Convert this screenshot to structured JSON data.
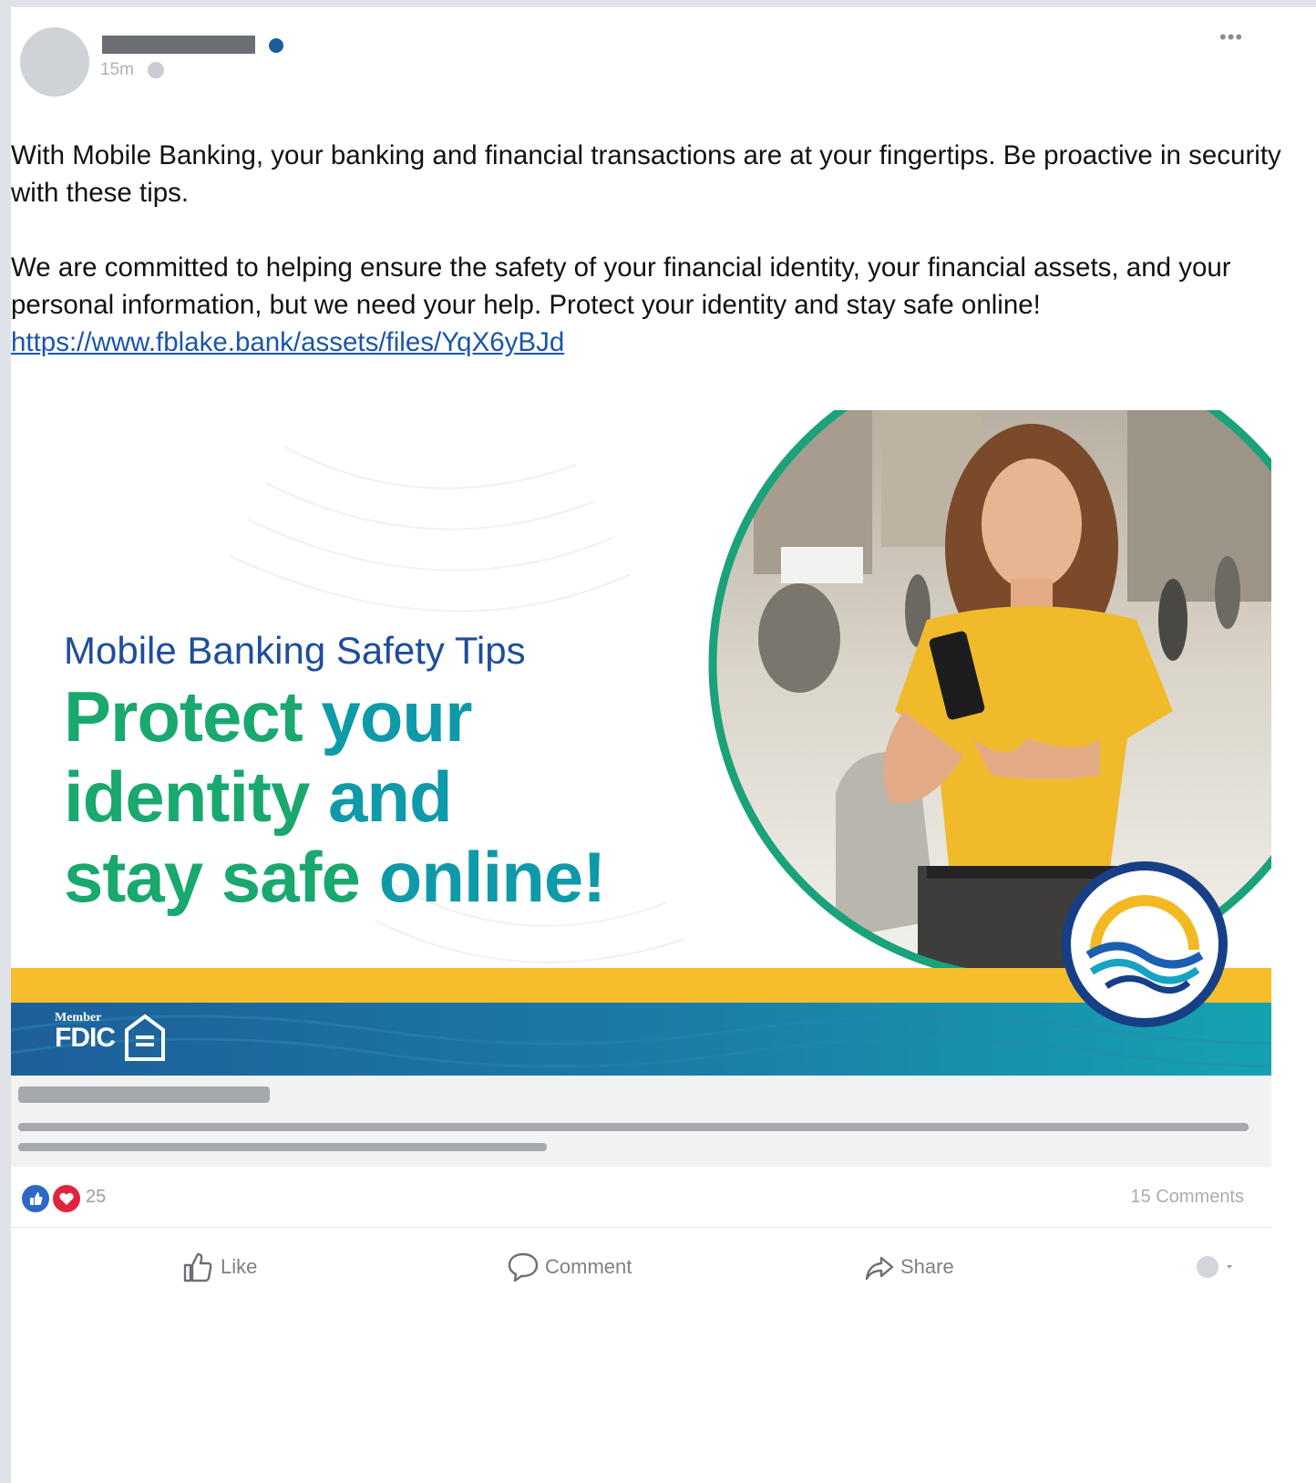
{
  "post": {
    "timestamp": "15m",
    "paragraph1": "With Mobile Banking, your banking and financial transactions are at your fingertips. Be proactive in security with these tips.",
    "paragraph2": "We are committed to helping ensure the safety of your financial identity, your financial assets, and your personal information, but we need your help. Protect your identity and stay safe online!",
    "link": "https://www.fblake.bank/assets/files/YqX6yBJd",
    "more_icon": "more-options-icon"
  },
  "ad": {
    "subtitle": "Mobile Banking Safety Tips",
    "headline_line1_a": "Protect ",
    "headline_line1_b": "your",
    "headline_line2_a": "identity ",
    "headline_line2_b": "and",
    "headline_line3_a": "stay safe ",
    "headline_line3_b": "online!",
    "fdic_member": "Member",
    "fdic_word": "FDIC",
    "colors": {
      "green": "#19a86e",
      "teal": "#0e9aa8",
      "navy": "#1e4d9c",
      "yellow": "#f6bd2c",
      "blue": "#1d5f9a"
    }
  },
  "engagement": {
    "reaction_count": "25",
    "comments": "15 Comments",
    "actions": {
      "like": "Like",
      "comment": "Comment",
      "share": "Share"
    }
  }
}
